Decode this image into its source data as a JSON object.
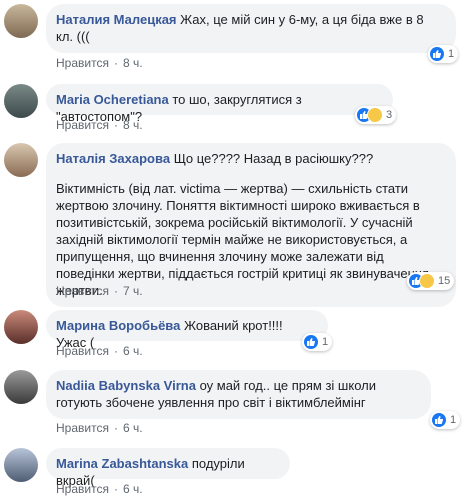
{
  "actions": {
    "like_label": "Нравится",
    "dot": "·"
  },
  "comments": [
    {
      "author": "Наталия Малецкая",
      "text": "Жах, це мій син у 6-му, а ця біда вже в 8 кл. (((",
      "time": "8 ч.",
      "reaction_count": "1"
    },
    {
      "author": "Maria Ocheretiana",
      "text": "то шо, закруглятися з \"автостопом\"?",
      "time": "8 ч.",
      "reaction_count": "3"
    },
    {
      "author": "Наталія Захарова",
      "text": "Що це???? Назад в расіюшку???",
      "paragraph": "Віктимність (від лат. victima — жертва) — схильність стати жертвою злочину. Поняття віктимності широко вживається в позитивістській, зокрема російській віктимології. У сучасній західній віктимології термін майже не використовується, а припущення, що вчинення злочину може залежати від поведінки жертви, піддається гострій критиці як звинувачення жертви.",
      "time": "7 ч.",
      "reaction_count": "15"
    },
    {
      "author": "Марина Воробьёва",
      "text": "Жований крот!!!! Ужас (",
      "time": "6 ч.",
      "reaction_count": "1"
    },
    {
      "author": "Nadiia Babynska Virna",
      "text": "оу май год.. це прям зі школи готують збочене уявлення про світ і віктимблеймінг",
      "time": "6 ч.",
      "reaction_count": "1"
    },
    {
      "author": "Marina Zabashtanska",
      "text": "подуріли вкрай(",
      "time": "6 ч."
    }
  ],
  "colors": {
    "author": "#385898",
    "bubble": "#f2f3f5",
    "like": "#1877f2"
  }
}
